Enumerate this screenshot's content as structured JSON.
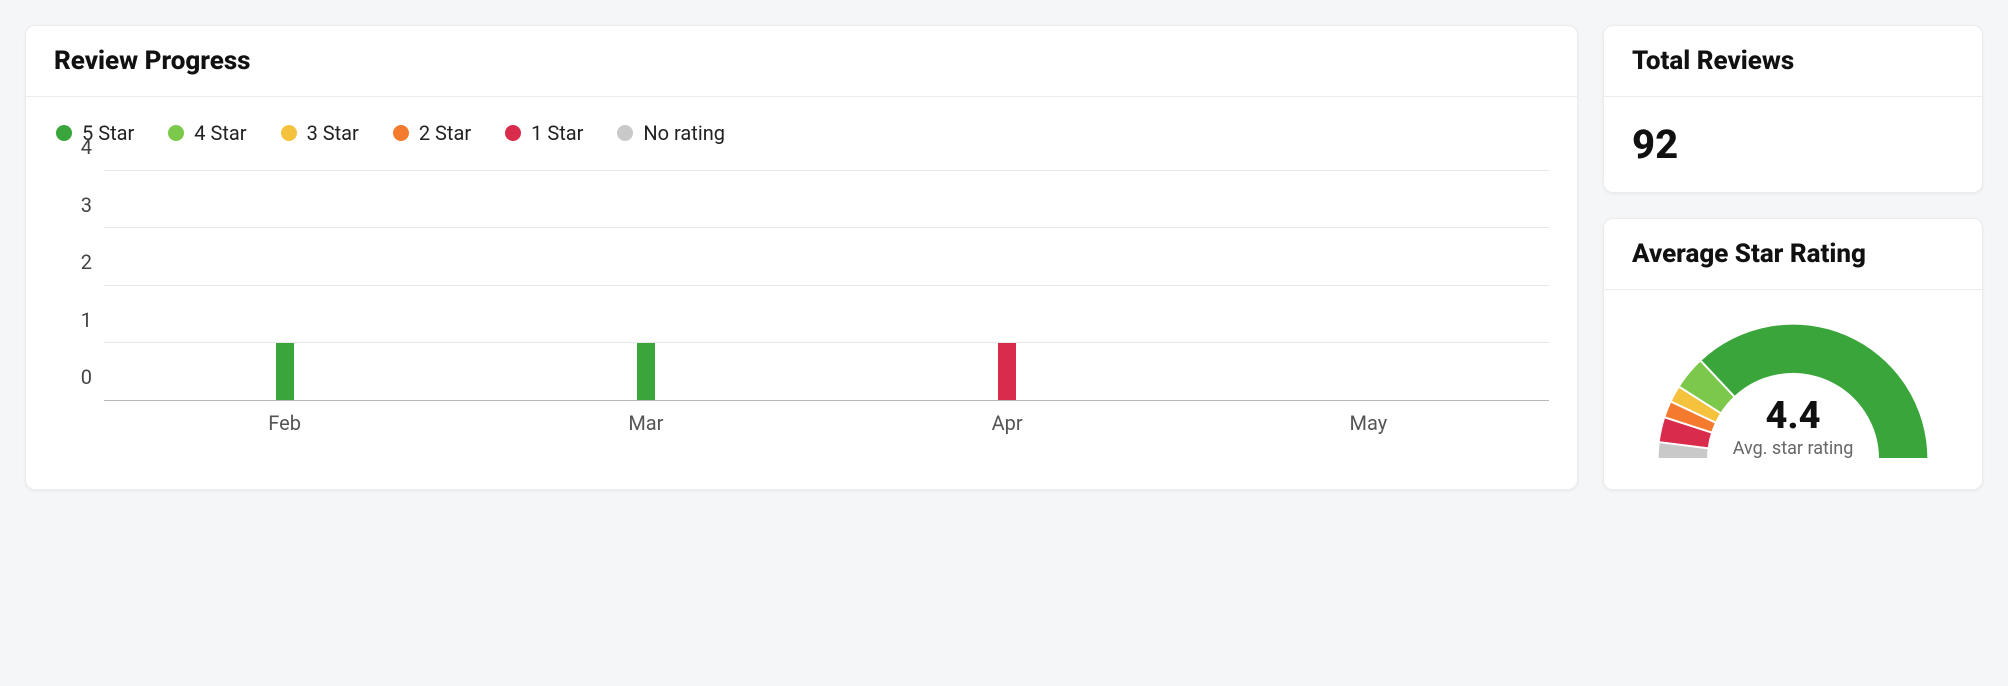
{
  "colors": {
    "star5": "#3aa53a",
    "star4": "#7cc84a",
    "star3": "#f5c23d",
    "star2": "#f47a2e",
    "star1": "#d92b4b",
    "norating": "#c9c9c9"
  },
  "review_progress": {
    "title": "Review Progress",
    "legend": [
      {
        "label": "5 Star",
        "colorKey": "star5"
      },
      {
        "label": "4 Star",
        "colorKey": "star4"
      },
      {
        "label": "3 Star",
        "colorKey": "star3"
      },
      {
        "label": "2 Star",
        "colorKey": "star2"
      },
      {
        "label": "1 Star",
        "colorKey": "star1"
      },
      {
        "label": "No rating",
        "colorKey": "norating"
      }
    ]
  },
  "total_reviews": {
    "title": "Total Reviews",
    "value": "92"
  },
  "avg_rating": {
    "title": "Average Star Rating",
    "value": "4.4",
    "subtitle": "Avg. star rating",
    "segments": [
      {
        "colorKey": "norating",
        "pct": 4
      },
      {
        "colorKey": "star1",
        "pct": 6
      },
      {
        "colorKey": "star2",
        "pct": 4
      },
      {
        "colorKey": "star3",
        "pct": 4
      },
      {
        "colorKey": "star4",
        "pct": 8
      },
      {
        "colorKey": "star5",
        "pct": 74
      }
    ]
  },
  "chart_data": {
    "type": "bar",
    "ylim": [
      0,
      4
    ],
    "yticks": [
      0,
      1,
      2,
      3,
      4
    ],
    "categories": [
      "Feb",
      "Mar",
      "Apr",
      "May"
    ],
    "series": [
      {
        "name": "5 Star",
        "colorKey": "star5",
        "values": [
          1,
          1,
          0,
          0
        ]
      },
      {
        "name": "4 Star",
        "colorKey": "star4",
        "values": [
          0,
          0,
          0,
          0
        ]
      },
      {
        "name": "3 Star",
        "colorKey": "star3",
        "values": [
          0,
          0,
          0,
          0
        ]
      },
      {
        "name": "2 Star",
        "colorKey": "star2",
        "values": [
          0,
          0,
          0,
          0
        ]
      },
      {
        "name": "1 Star",
        "colorKey": "star1",
        "values": [
          0,
          0,
          1,
          0
        ]
      },
      {
        "name": "No rating",
        "colorKey": "norating",
        "values": [
          0,
          0,
          0,
          0
        ]
      }
    ]
  }
}
